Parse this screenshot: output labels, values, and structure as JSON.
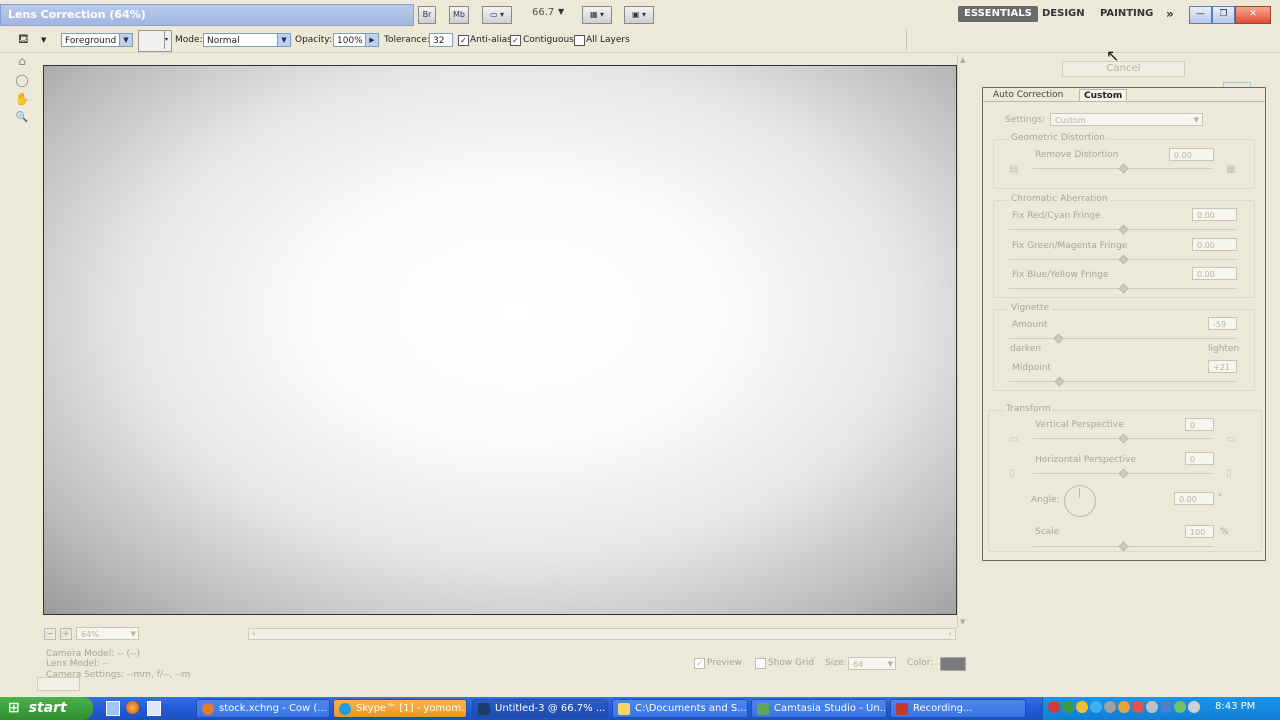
{
  "window": {
    "title": "Lens Correction (64%)",
    "bridge_btn": "Br",
    "minibridge_btn": "Mb",
    "zoom_value": "66.7",
    "workspaces": [
      "ESSENTIALS",
      "DESIGN",
      "PAINTING"
    ],
    "more_ws": "»",
    "controls": {
      "min": "—",
      "restore": "❐",
      "close": "✕"
    }
  },
  "options_bar": {
    "fill_source": "Foreground",
    "mode_label": "Mode:",
    "mode_value": "Normal",
    "opacity_label": "Opacity:",
    "opacity_value": "100%",
    "tolerance_label": "Tolerance:",
    "tolerance_value": "32",
    "anti_alias": "Anti-alias",
    "contiguous": "Contiguous",
    "all_layers": "All Layers"
  },
  "tools": {
    "a": "⌂",
    "b": "◯",
    "c": "✋",
    "d": "🔍"
  },
  "canvas_footer": {
    "zoom": "64%",
    "camera_model": "Camera Model: -- (--)",
    "lens_model": "Lens Model: --",
    "camera_settings": "Camera Settings: --mm, f/--, --m",
    "preview": "Preview",
    "show_grid": "Show Grid",
    "size_label": "Size:",
    "size_value": "64",
    "color_label": "Color:",
    "grid_color": "#7b7b7b"
  },
  "dialog": {
    "cancel": "Cancel",
    "tabs": [
      "Auto Correction",
      "Custom"
    ],
    "settings_label": "Settings:",
    "settings_value": "Custom",
    "geometric": {
      "title": "Geometric Distortion",
      "remove_distortion_label": "Remove Distortion",
      "remove_distortion_value": "0.00"
    },
    "chromatic": {
      "title": "Chromatic Aberration",
      "red_cyan_label": "Fix Red/Cyan Fringe",
      "red_cyan_value": "0.00",
      "green_magenta_label": "Fix Green/Magenta Fringe",
      "green_magenta_value": "0.00",
      "blue_yellow_label": "Fix Blue/Yellow Fringe",
      "blue_yellow_value": "0.00"
    },
    "vignette": {
      "title": "Vignette",
      "amount_label": "Amount",
      "amount_value": "-59",
      "darken": "darken",
      "lighten": "lighten",
      "midpoint_label": "Midpoint",
      "midpoint_value": "+21"
    },
    "transform": {
      "title": "Transform",
      "vertical_label": "Vertical Perspective",
      "vertical_value": "0",
      "horizontal_label": "Horizontal Perspective",
      "horizontal_value": "0",
      "angle_label": "Angle:",
      "angle_value": "0.00",
      "angle_unit": "°",
      "scale_label": "Scale",
      "scale_value": "100",
      "scale_unit": "%"
    }
  },
  "taskbar": {
    "start": "start",
    "tasks": [
      "stock.xchng - Cow (...",
      "Skype™ [1] - yomom...",
      "Untitled-3 @ 66.7% ...",
      "C:\\Documents and S...",
      "Camtasia Studio - Un...",
      "Recording..."
    ],
    "clock": "8:43 PM"
  }
}
